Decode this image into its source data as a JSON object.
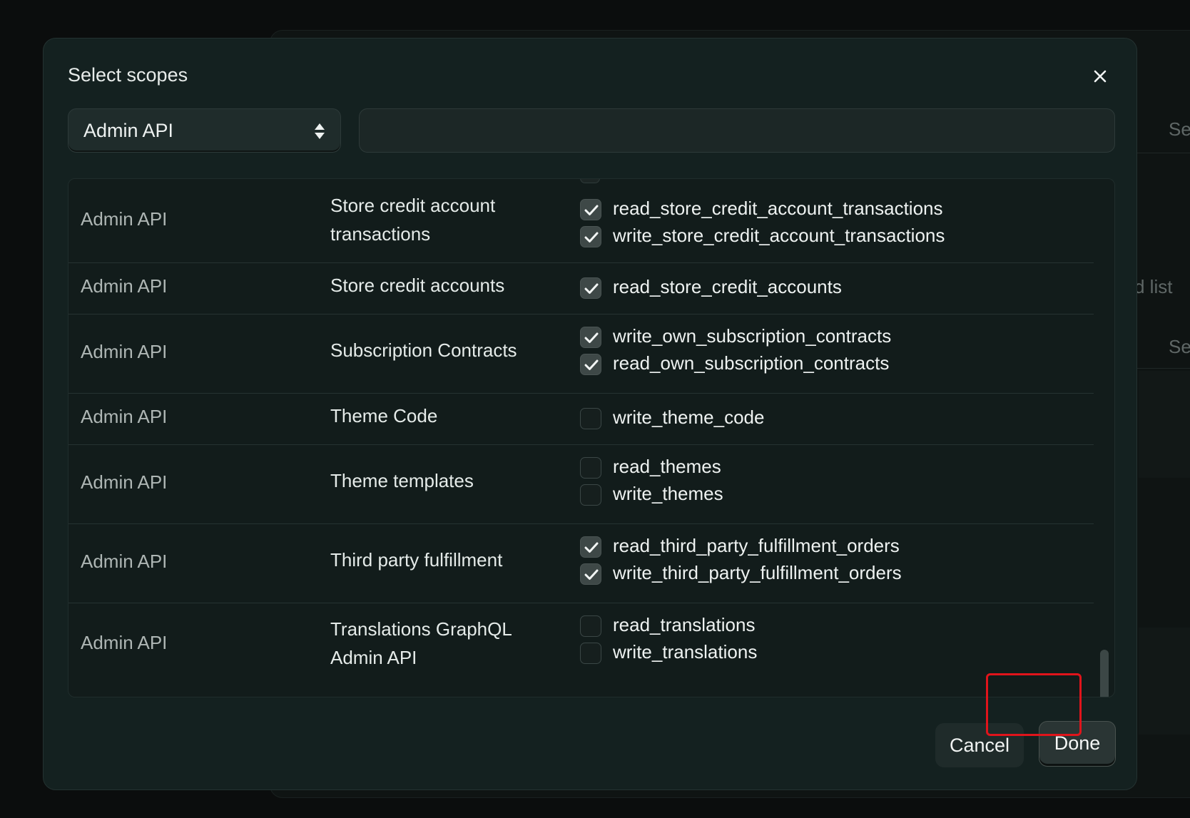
{
  "background": {
    "text_1": "Se",
    "text_2": "d list",
    "text_3": "Se"
  },
  "modal": {
    "title": "Select scopes",
    "close_icon": "close-icon",
    "api_select": {
      "value": "Admin API",
      "icon": "sort-icon"
    },
    "search": {
      "value": "",
      "placeholder": ""
    },
    "rows": [
      {
        "api": "Admin API",
        "resource": "Store credit account transactions",
        "scopes": [
          {
            "name": "read_store_credit_account_transactions",
            "checked": true
          },
          {
            "name": "write_store_credit_account_transactions",
            "checked": true
          }
        ]
      },
      {
        "api": "Admin API",
        "resource": "Store credit accounts",
        "scopes": [
          {
            "name": "read_store_credit_accounts",
            "checked": true
          }
        ]
      },
      {
        "api": "Admin API",
        "resource": "Subscription Contracts",
        "scopes": [
          {
            "name": "write_own_subscription_contracts",
            "checked": true
          },
          {
            "name": "read_own_subscription_contracts",
            "checked": true
          }
        ]
      },
      {
        "api": "Admin API",
        "resource": "Theme Code",
        "scopes": [
          {
            "name": "write_theme_code",
            "checked": false
          }
        ]
      },
      {
        "api": "Admin API",
        "resource": "Theme templates",
        "scopes": [
          {
            "name": "read_themes",
            "checked": false
          },
          {
            "name": "write_themes",
            "checked": false
          }
        ]
      },
      {
        "api": "Admin API",
        "resource": "Third party fulfillment",
        "scopes": [
          {
            "name": "read_third_party_fulfillment_orders",
            "checked": true
          },
          {
            "name": "write_third_party_fulfillment_orders",
            "checked": true
          }
        ]
      },
      {
        "api": "Admin API",
        "resource": "Translations GraphQL Admin API",
        "scopes": [
          {
            "name": "read_translations",
            "checked": false
          },
          {
            "name": "write_translations",
            "checked": false
          }
        ]
      }
    ],
    "footer": {
      "cancel_label": "Cancel",
      "done_label": "Done"
    },
    "highlight_color": "#e0141b"
  }
}
